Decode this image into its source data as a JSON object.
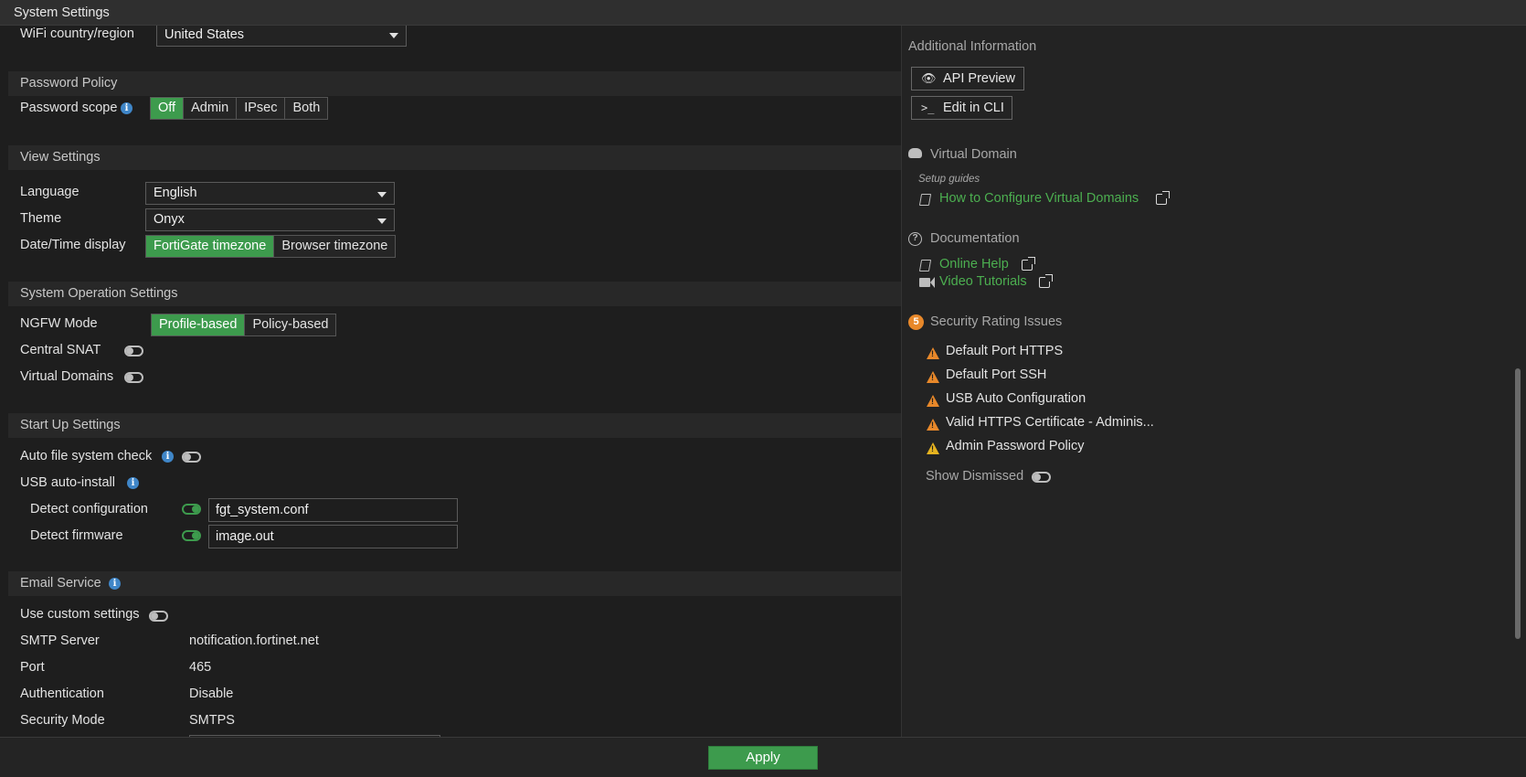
{
  "window": {
    "title": "System Settings"
  },
  "wifi": {
    "label": "WiFi country/region",
    "value": "United States"
  },
  "password_policy": {
    "header": "Password Policy",
    "scope_label": "Password scope",
    "options": [
      "Off",
      "Admin",
      "IPsec",
      "Both"
    ],
    "selected": "Off"
  },
  "view_settings": {
    "header": "View Settings",
    "language_label": "Language",
    "language_value": "English",
    "theme_label": "Theme",
    "theme_value": "Onyx",
    "datetime_label": "Date/Time display",
    "datetime_options": [
      "FortiGate timezone",
      "Browser timezone"
    ],
    "datetime_selected": "FortiGate timezone"
  },
  "system_operation": {
    "header": "System Operation Settings",
    "ngfw_label": "NGFW Mode",
    "ngfw_options": [
      "Profile-based",
      "Policy-based"
    ],
    "ngfw_selected": "Profile-based",
    "central_snat_label": "Central SNAT",
    "central_snat_on": false,
    "virtual_domains_label": "Virtual Domains",
    "virtual_domains_on": false
  },
  "startup": {
    "header": "Start Up Settings",
    "auto_fs_label": "Auto file system check",
    "auto_fs_on": false,
    "usb_label": "USB auto-install",
    "detect_config_label": "Detect configuration",
    "detect_config_on": true,
    "detect_config_value": "fgt_system.conf",
    "detect_firmware_label": "Detect firmware",
    "detect_firmware_on": true,
    "detect_firmware_value": "image.out"
  },
  "email": {
    "header": "Email Service",
    "custom_label": "Use custom settings",
    "custom_on": false,
    "smtp_label": "SMTP Server",
    "smtp_value": "notification.fortinet.net",
    "port_label": "Port",
    "port_value": "465",
    "auth_label": "Authentication",
    "auth_value": "Disable",
    "security_label": "Security Mode",
    "security_value": "SMTPS"
  },
  "sidebar": {
    "additional_info": "Additional Information",
    "api_preview": "API Preview",
    "edit_cli": "Edit in CLI",
    "virtual_domain": "Virtual Domain",
    "setup_guides": "Setup guides",
    "how_to_vdom": "How to Configure Virtual Domains",
    "documentation": "Documentation",
    "online_help": "Online Help",
    "video_tutorials": "Video Tutorials",
    "security_rating": "Security Rating Issues",
    "security_count": "5",
    "issues": [
      "Default Port HTTPS",
      "Default Port SSH",
      "USB Auto Configuration",
      "Valid HTTPS Certificate - Adminis...",
      "Admin Password Policy"
    ],
    "show_dismissed": "Show Dismissed",
    "show_dismissed_on": false
  },
  "footer": {
    "apply": "Apply"
  },
  "colors": {
    "accent": "#3d9b4d",
    "link": "#4caf50",
    "warning": "#e8882a",
    "info": "#3f86c8"
  }
}
